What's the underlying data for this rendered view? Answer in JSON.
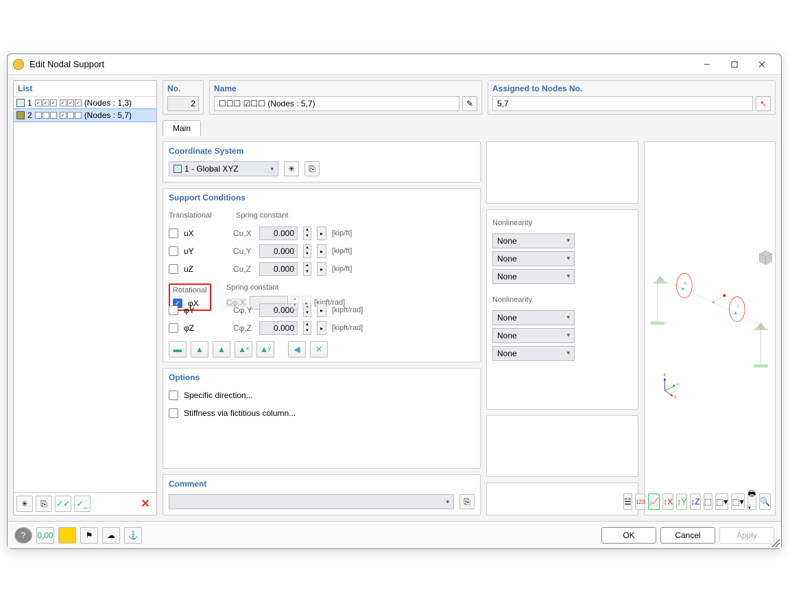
{
  "window": {
    "title": "Edit Nodal Support"
  },
  "list": {
    "header": "List",
    "items": [
      {
        "idx": "1",
        "label": "(Nodes : 1,3)",
        "color": "#d8f0f3"
      },
      {
        "idx": "2",
        "label": "(Nodes : 5,7)",
        "color": "#b0a030"
      }
    ]
  },
  "no": {
    "label": "No.",
    "value": "2"
  },
  "name": {
    "label": "Name",
    "value": "☐☐☐ ☑☐☐ (Nodes : 5,7)"
  },
  "assigned": {
    "label": "Assigned to Nodes No.",
    "value": "5,7"
  },
  "tabs": {
    "main": "Main"
  },
  "coord": {
    "header": "Coordinate System",
    "value": "1 - Global XYZ"
  },
  "support": {
    "header": "Support Conditions",
    "trans_label": "Translational",
    "rot_label": "Rotational",
    "spring_label": "Spring constant",
    "nonlin_label": "Nonlinearity",
    "ux": {
      "sym": "uX",
      "k": "Cu,X",
      "v": "0.000",
      "unit": "[kip/ft]",
      "nl": "None"
    },
    "uy": {
      "sym": "uY",
      "k": "Cu,Y",
      "v": "0.000",
      "unit": "[kip/ft]",
      "nl": "None"
    },
    "uz": {
      "sym": "uZ",
      "k": "Cu,Z",
      "v": "0.000",
      "unit": "[kip/ft]",
      "nl": "None"
    },
    "phix": {
      "sym": "φX",
      "k": "Cφ,X",
      "v": "",
      "unit": "[kipft/rad]",
      "nl": "None"
    },
    "phiy": {
      "sym": "φY",
      "k": "Cφ,Y",
      "v": "0.000",
      "unit": "[kipft/rad]",
      "nl": "None"
    },
    "phiz": {
      "sym": "φZ",
      "k": "Cφ,Z",
      "v": "0.000",
      "unit": "[kipft/rad]",
      "nl": "None"
    }
  },
  "options": {
    "header": "Options",
    "specific": "Specific direction...",
    "fictitious": "Stiffness via fictitious column..."
  },
  "comment": {
    "header": "Comment"
  },
  "preview": {
    "node5": "5",
    "node7": "7",
    "axisX": "X",
    "axisY": "Y",
    "axisZ": "Z"
  },
  "buttons": {
    "ok": "OK",
    "cancel": "Cancel",
    "apply": "Apply"
  }
}
